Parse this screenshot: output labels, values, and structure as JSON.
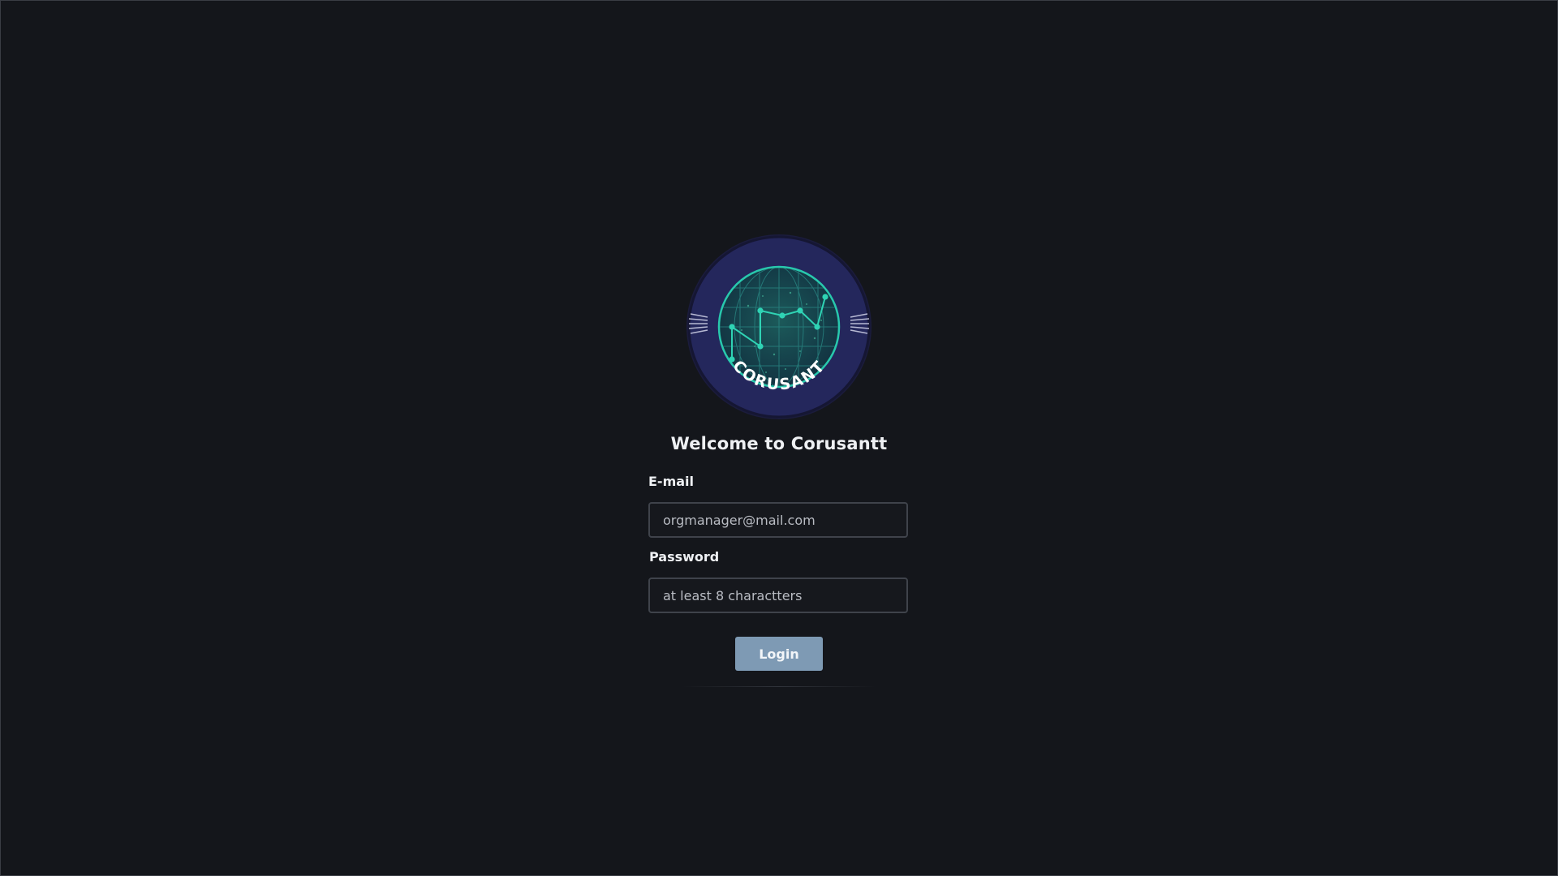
{
  "app": {
    "logo_text": "CORUSANT",
    "title": "Welcome to Corusantt"
  },
  "form": {
    "email": {
      "label": "E-mail",
      "value": "",
      "placeholder": "orgmanager@mail.com"
    },
    "password": {
      "label": "Password",
      "value": "",
      "placeholder": "at least 8 charactters"
    },
    "login_label": "Login"
  },
  "colors": {
    "background": "#14161b",
    "logo_ring": "#1f2150",
    "logo_globe": "#1fc2a8",
    "button": "#7e9ab4"
  }
}
